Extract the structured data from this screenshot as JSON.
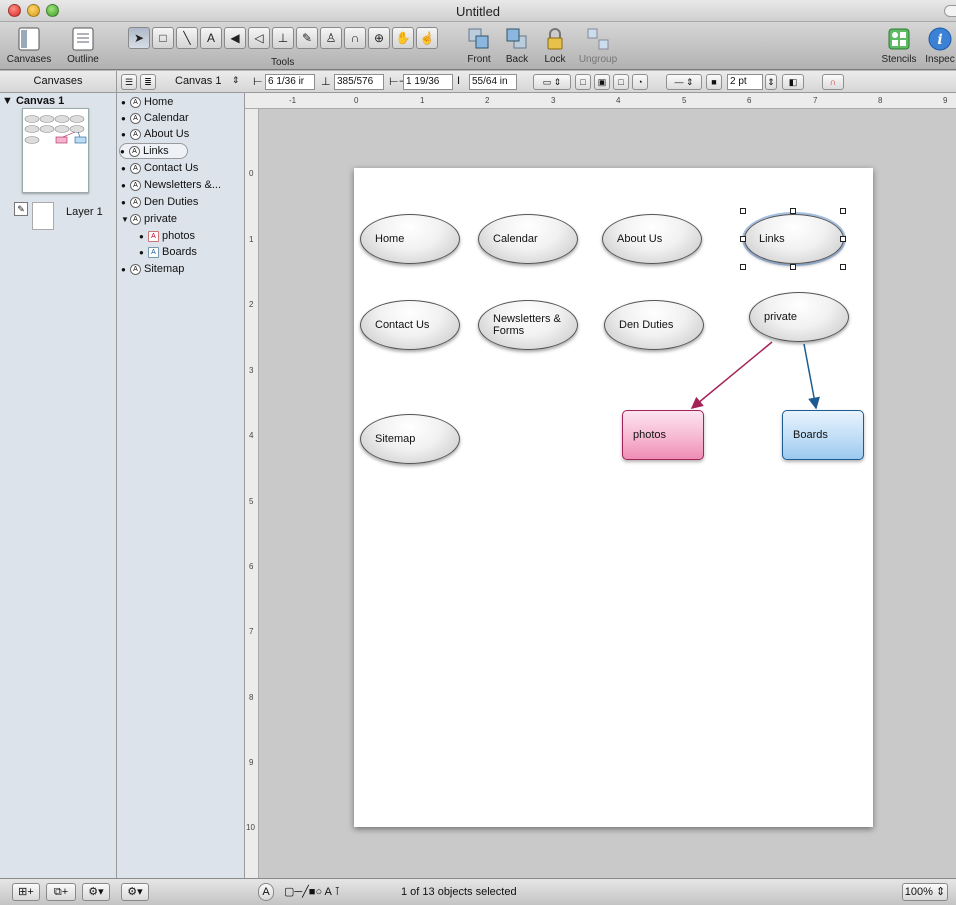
{
  "window": {
    "title": "Untitled"
  },
  "toolbar": {
    "canvases_label": "Canvases",
    "outline_label": "Outline",
    "tools_label": "Tools",
    "front_label": "Front",
    "back_label": "Back",
    "lock_label": "Lock",
    "ungroup_label": "Ungroup",
    "stencils_label": "Stencils",
    "inspectors_label": "Inspec"
  },
  "header": {
    "canvases_title": "Canvases",
    "canvas_select": "Canvas 1",
    "x_field": "6 1/36 ir",
    "y_field": "385/576",
    "w_field": "1 19/36",
    "h_field": "55/64 in",
    "stroke_width": "2 pt"
  },
  "canvases": {
    "item": "▼ Canvas 1",
    "layer": "Layer 1"
  },
  "outline": {
    "items": [
      {
        "label": "Home",
        "bullet": "●",
        "badge": "A"
      },
      {
        "label": "Calendar",
        "bullet": "●",
        "badge": "A"
      },
      {
        "label": "About Us",
        "bullet": "●",
        "badge": "A"
      },
      {
        "label": "Links",
        "bullet": "●",
        "badge": "A"
      },
      {
        "label": "Contact Us",
        "bullet": "●",
        "badge": "A"
      },
      {
        "label": "Newsletters &...",
        "bullet": "●",
        "badge": "A"
      },
      {
        "label": "Den Duties",
        "bullet": "●",
        "badge": "A"
      },
      {
        "label": "private",
        "bullet": "▼",
        "badge": "A"
      },
      {
        "label": "photos",
        "bullet": "●",
        "badge": "A"
      },
      {
        "label": "Boards",
        "bullet": "●",
        "badge": "A"
      },
      {
        "label": "Sitemap",
        "bullet": "●",
        "badge": "A"
      }
    ]
  },
  "rulers": {
    "top": [
      "-1",
      "0",
      "1",
      "2",
      "3",
      "4",
      "5",
      "6",
      "7",
      "8",
      "9"
    ],
    "left": [
      "0",
      "1",
      "2",
      "3",
      "4",
      "5",
      "6",
      "7",
      "8",
      "9",
      "10"
    ]
  },
  "diagram": {
    "nodes": {
      "home": "Home",
      "calendar": "Calendar",
      "about": "About Us",
      "links": "Links",
      "contact": "Contact Us",
      "newsletters": "Newsletters & Forms",
      "den": "Den Duties",
      "private": "private",
      "sitemap": "Sitemap",
      "photos": "photos",
      "boards": "Boards"
    },
    "colors": {
      "photos_line": "#a32359",
      "boards_line": "#1c5c92"
    }
  },
  "status": {
    "selection": "1 of 13 objects selected",
    "zoom": "100%"
  }
}
